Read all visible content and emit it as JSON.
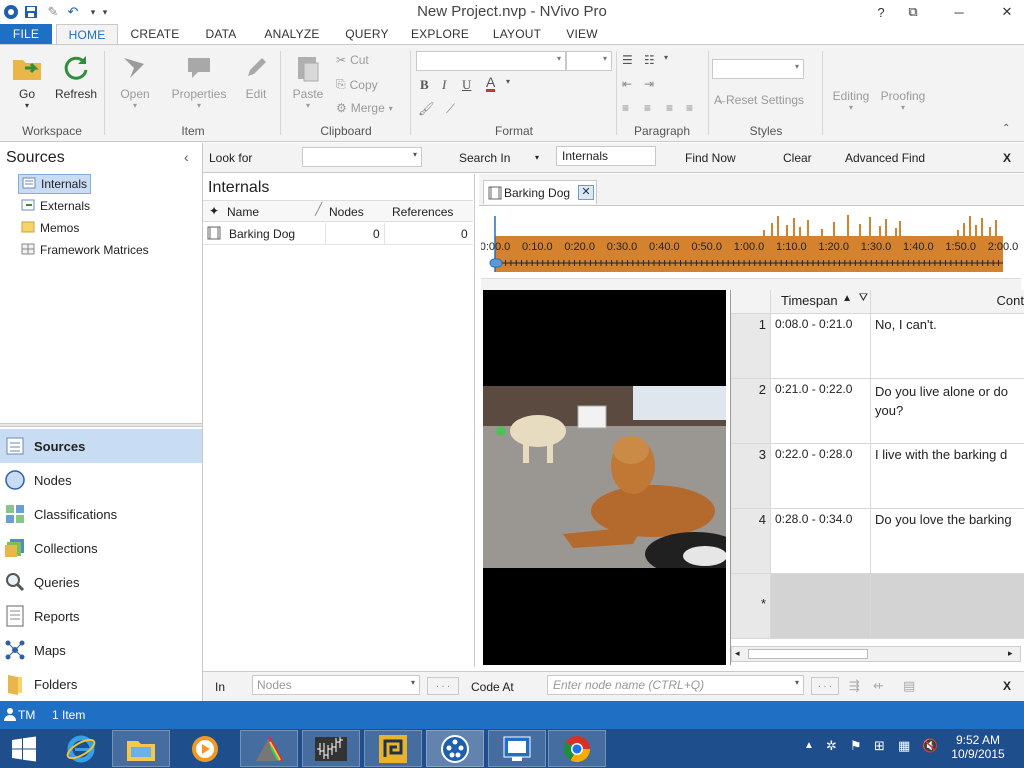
{
  "window": {
    "title": "New Project.nvp - NVivo Pro",
    "controls": {
      "help": "?",
      "restore": "⧉",
      "minimize": "─",
      "close": "✕"
    }
  },
  "ribbon_tabs": [
    "FILE",
    "HOME",
    "CREATE",
    "DATA",
    "ANALYZE",
    "QUERY",
    "EXPLORE",
    "LAYOUT",
    "VIEW"
  ],
  "ribbon": {
    "workspace": {
      "go": "Go",
      "refresh": "Refresh",
      "group": "Workspace"
    },
    "item": {
      "open": "Open",
      "properties": "Properties",
      "edit": "Edit",
      "group": "Item"
    },
    "clipboard": {
      "paste": "Paste",
      "cut": "Cut",
      "copy": "Copy",
      "merge": "Merge",
      "group": "Clipboard"
    },
    "format": {
      "bold": "B",
      "italic": "I",
      "underline": "U",
      "font_color": "A",
      "group": "Format"
    },
    "paragraph": {
      "group": "Paragraph"
    },
    "styles": {
      "reset_settings": "Reset Settings",
      "group": "Styles"
    },
    "editing": "Editing",
    "proofing": "Proofing"
  },
  "sources_panel": {
    "title": "Sources",
    "tree": [
      "Internals",
      "Externals",
      "Memos",
      "Framework Matrices"
    ],
    "selected": "Internals"
  },
  "nav": [
    "Sources",
    "Nodes",
    "Classifications",
    "Collections",
    "Queries",
    "Reports",
    "Maps",
    "Folders"
  ],
  "find_bar": {
    "look_for": "Look for",
    "search_in": "Search In",
    "search_in_value": "Internals",
    "find_now": "Find Now",
    "clear": "Clear",
    "advanced_find": "Advanced Find",
    "close": "X"
  },
  "list_view": {
    "title": "Internals",
    "columns": [
      "Name",
      "Nodes",
      "References"
    ],
    "rows": [
      {
        "name": "Barking Dog",
        "nodes": "0",
        "references": "0"
      }
    ]
  },
  "media": {
    "tab": "Barking Dog",
    "timeline_ticks": [
      "0:00.0",
      "0:10.0",
      "0:20.0",
      "0:30.0",
      "0:40.0",
      "0:50.0",
      "1:00.0",
      "1:10.0",
      "1:20.0",
      "1:30.0",
      "1:40.0",
      "1:50.0",
      "2:00.0"
    ],
    "transcript_columns": [
      "Timespan",
      "Cont"
    ],
    "transcript_rows": [
      {
        "num": "1",
        "timespan": "0:08.0 - 0:21.0",
        "content": "No, I can't."
      },
      {
        "num": "2",
        "timespan": "0:21.0 - 0:22.0",
        "content": "Do you live alone or do you?"
      },
      {
        "num": "3",
        "timespan": "0:22.0 - 0:28.0",
        "content": "I live with the barking d"
      },
      {
        "num": "4",
        "timespan": "0:28.0 - 0:34.0",
        "content": "Do you love the barking"
      }
    ],
    "new_row_marker": "*"
  },
  "coding_bar": {
    "in_label": "In",
    "in_value": "Nodes",
    "code_at": "Code At",
    "node_placeholder": "Enter node name (CTRL+Q)",
    "ellipsis": ". . .",
    "close": "X"
  },
  "status_bar": {
    "user": "TM",
    "items": "1 Item"
  },
  "taskbar": {
    "apps": [
      "start",
      "internet-explorer",
      "file-explorer",
      "media-player",
      "nvivo-prism",
      "audio-wave",
      "project-app",
      "nvivo",
      "intel-app",
      "chrome"
    ],
    "time": "9:52 AM",
    "date": "10/9/2015"
  },
  "colors": {
    "accent": "#1f6fc5",
    "waveform": "#d4822d",
    "selection": "#c8dcf3"
  }
}
